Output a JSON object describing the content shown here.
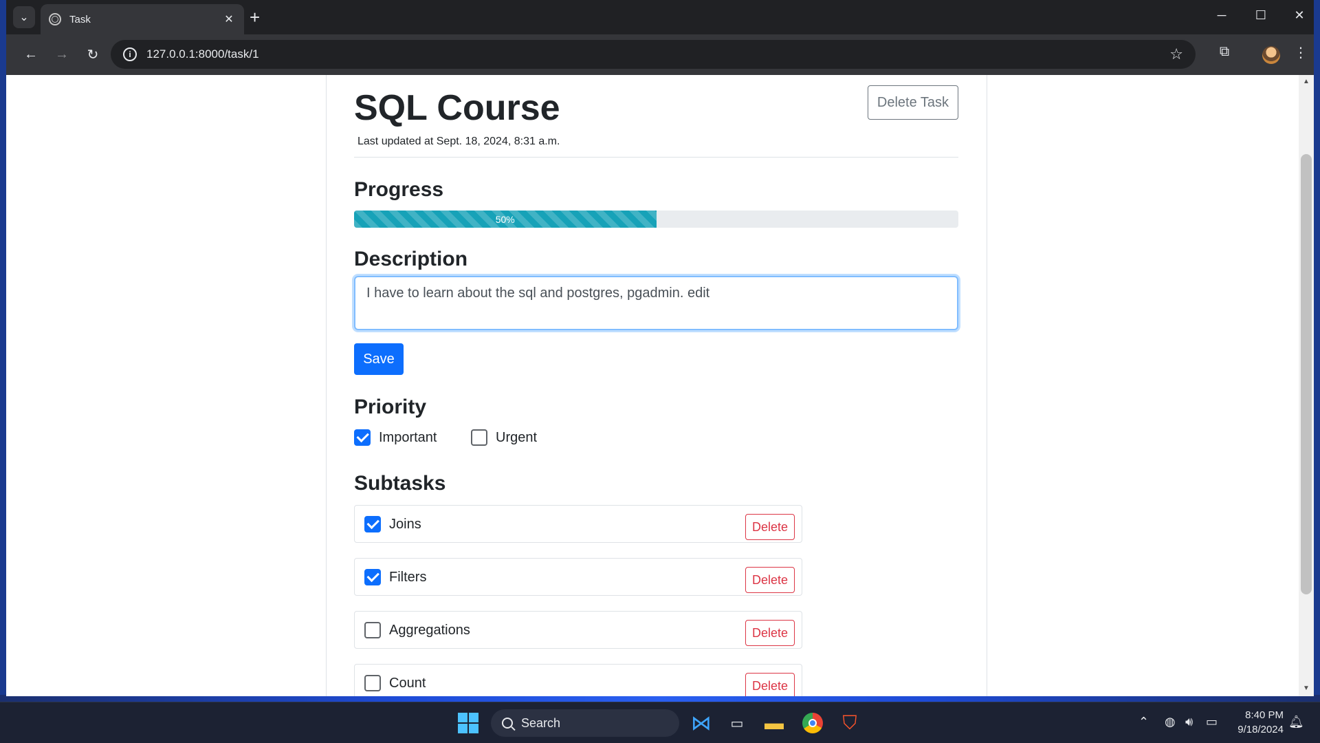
{
  "browser": {
    "tab_title": "Task",
    "tab_close": "✕",
    "new_tab": "+",
    "url": "127.0.0.1:8000/task/1"
  },
  "page": {
    "title": "SQL Course",
    "last_updated": "Last updated at Sept. 18, 2024, 8:31 a.m.",
    "delete_task_label": "Delete Task",
    "progress_heading": "Progress",
    "progress_percent": 50,
    "progress_label": "50%",
    "description_heading": "Description",
    "description_value": "I have to learn about the sql and postgres, pgadmin. edit",
    "save_label": "Save",
    "priority_heading": "Priority",
    "priority": [
      {
        "label": "Important",
        "checked": true
      },
      {
        "label": "Urgent",
        "checked": false
      }
    ],
    "subtasks_heading": "Subtasks",
    "subtasks": [
      {
        "label": "Joins",
        "checked": true,
        "delete_label": "Delete"
      },
      {
        "label": "Filters",
        "checked": true,
        "delete_label": "Delete"
      },
      {
        "label": "Aggregations",
        "checked": false,
        "delete_label": "Delete"
      },
      {
        "label": "Count",
        "checked": false,
        "delete_label": "Delete"
      }
    ]
  },
  "taskbar": {
    "search_label": "Search",
    "time": "8:40 PM",
    "date": "9/18/2024"
  },
  "colors": {
    "primary": "#0d6efd",
    "danger": "#dc3545",
    "progress": "#17a2b8"
  }
}
